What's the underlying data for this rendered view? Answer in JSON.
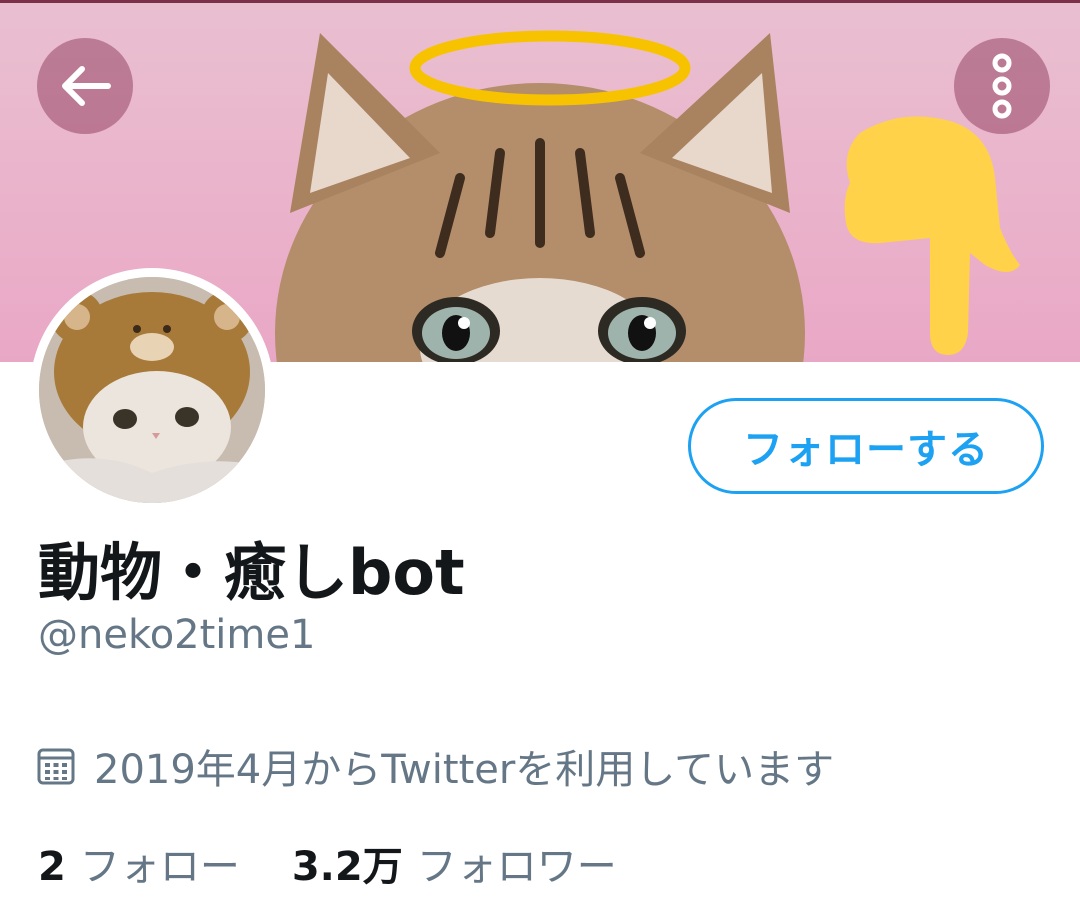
{
  "header": {
    "back_icon": "arrow-left-icon",
    "more_icon": "more-vertical-icon",
    "button_color": "#96466499"
  },
  "profile": {
    "display_name": "動物・癒しbot",
    "handle": "@neko2time1",
    "joined_text": "2019年4月からTwitterを利用しています",
    "joined_icon": "calendar-icon",
    "follow_label": "フォローする",
    "accent_color": "#1da1f2"
  },
  "stats": {
    "following_count": "2",
    "following_label": "フォロー",
    "followers_count": "3.2万",
    "followers_label": "フォロワー"
  }
}
